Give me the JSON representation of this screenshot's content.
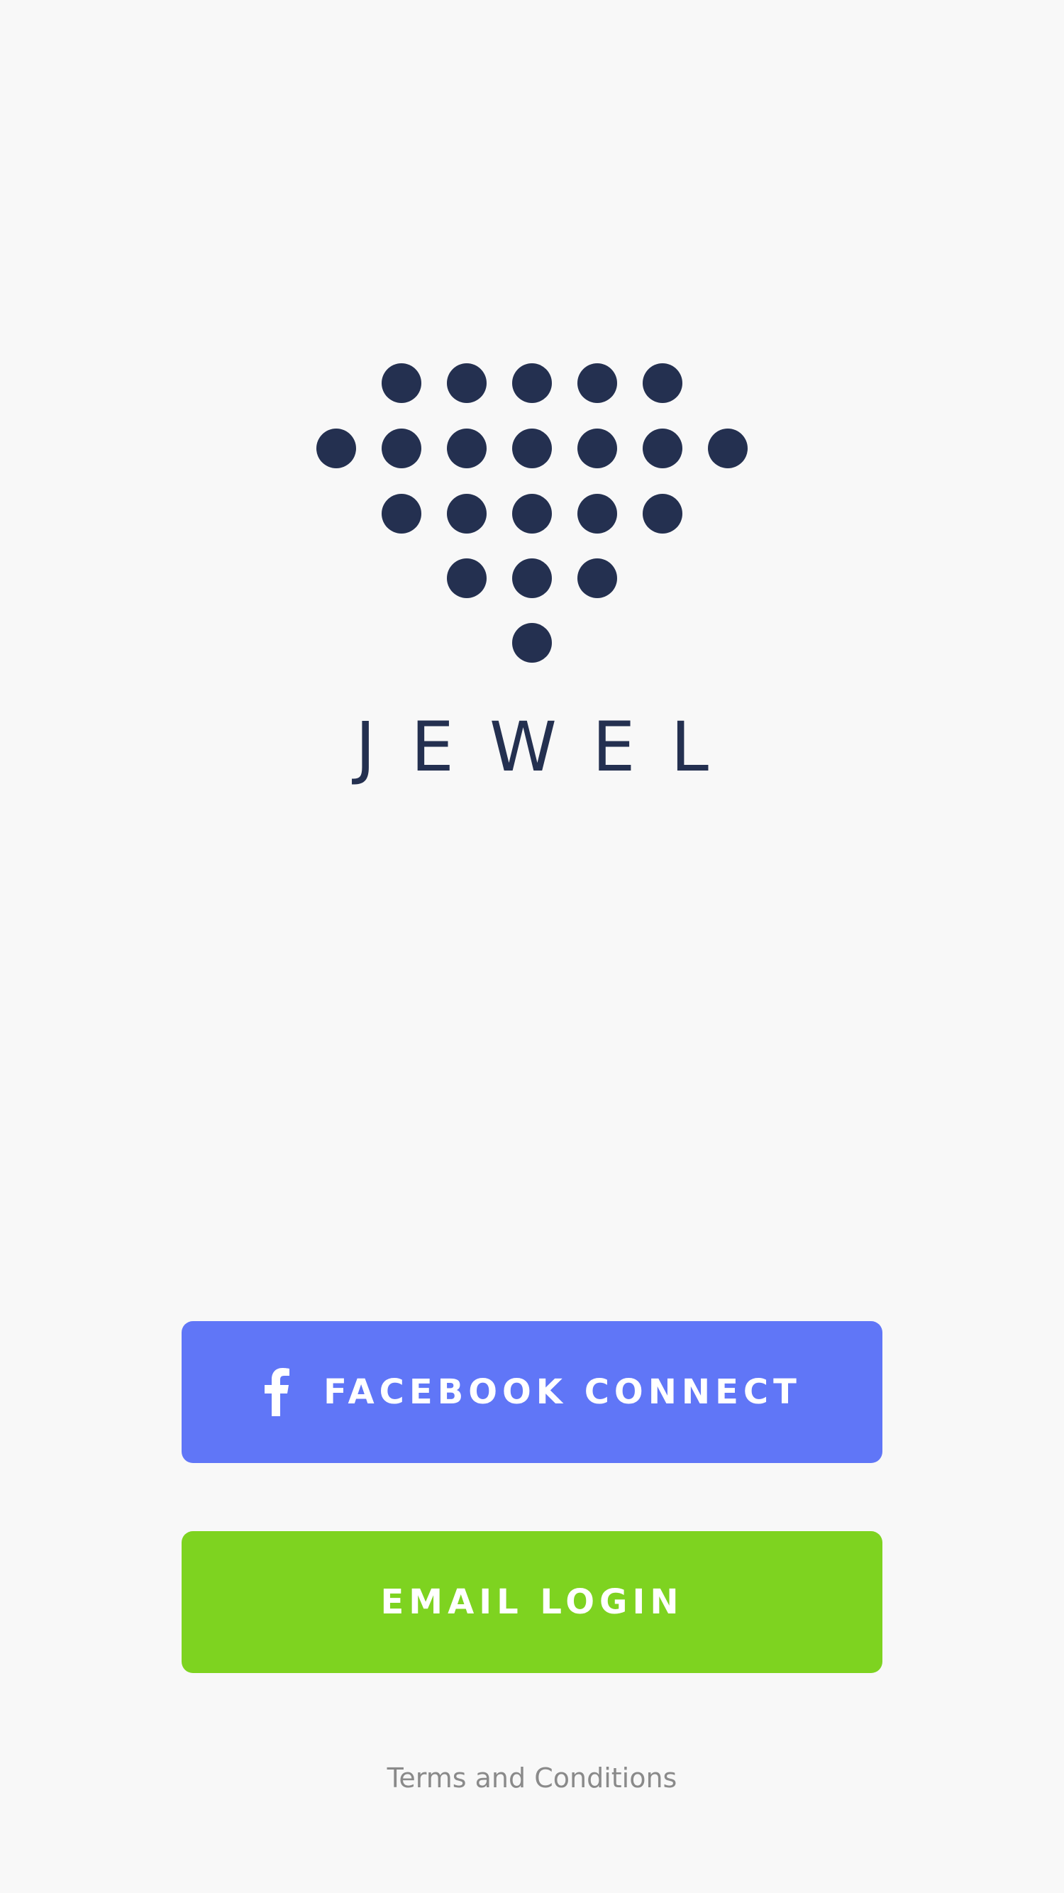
{
  "app": {
    "name": "JEWEL",
    "logo_icon": "jewel-dots-logo"
  },
  "buttons": {
    "facebook_label": "FACEBOOK CONNECT",
    "facebook_icon": "facebook-f-icon",
    "email_label": "EMAIL LOGIN"
  },
  "footer": {
    "terms_label": "Terms and Conditions"
  },
  "colors": {
    "background": "#f8f8f8",
    "brand_navy": "#243050",
    "facebook_blue": "#6076f7",
    "email_green": "#7ed320",
    "terms_gray": "#8a8a8a"
  }
}
